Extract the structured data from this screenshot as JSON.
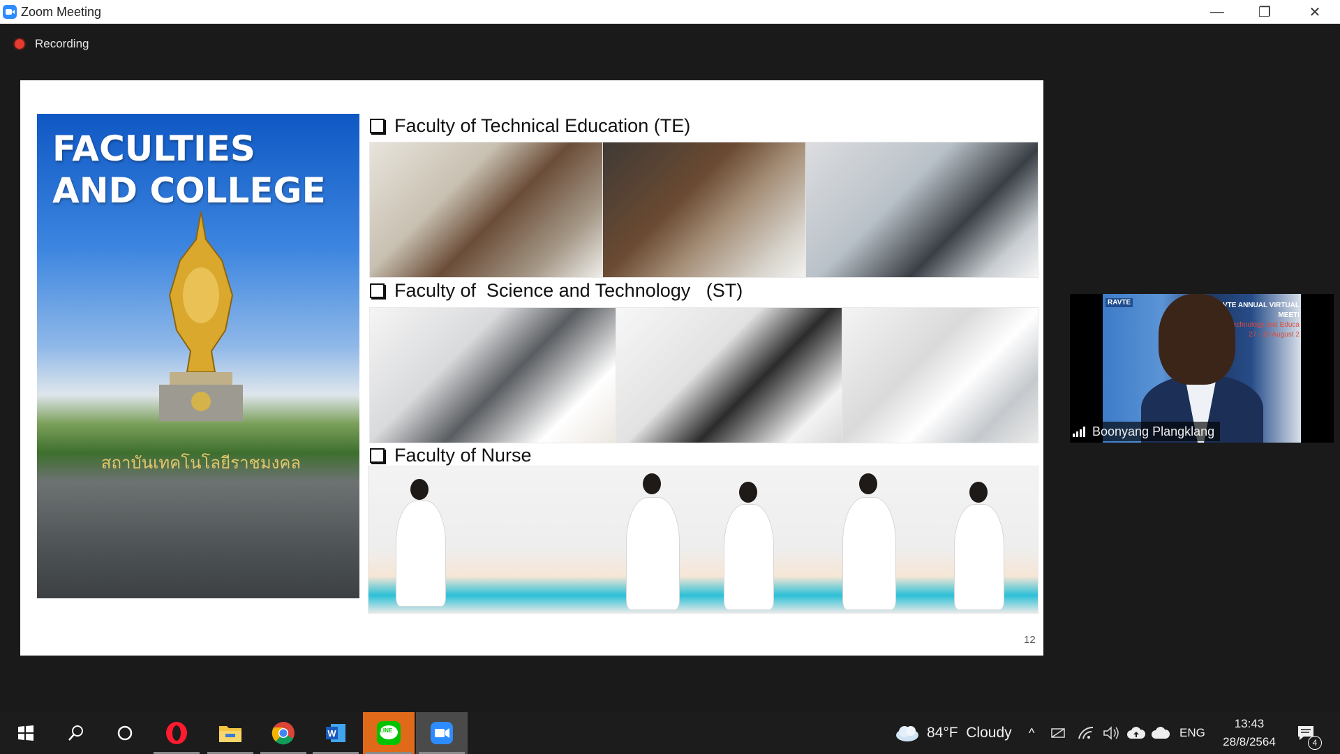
{
  "window": {
    "title": "Zoom Meeting",
    "minimize_glyph": "—",
    "restore_glyph": "❐",
    "close_glyph": "✕"
  },
  "recording": {
    "label": "Recording",
    "indicator_color": "#e63b2e"
  },
  "slide": {
    "hero_title": "FACULTIES AND COLLEGE",
    "hero_inscription": "สถาบันเทคโนโลยีราชมงคล",
    "sections": [
      {
        "heading": "Faculty of Technical Education (TE)"
      },
      {
        "heading": "Faculty of  Science and Technology   (ST)"
      },
      {
        "heading": "Faculty of Nurse"
      }
    ],
    "page_number": "12"
  },
  "participant": {
    "name": "Boonyang Plangklang",
    "banner_left": "RAVTE",
    "banner_right_1": "RAVTE ANNUAL VIRTUAL MEETI",
    "banner_right_2": "ersity of Technology and Educa",
    "banner_right_3": "27 - 28 August 2",
    "signal_icon": "signal-bars-icon"
  },
  "taskbar": {
    "apps": [
      {
        "name": "windows-start-icon"
      },
      {
        "name": "search-icon"
      },
      {
        "name": "cortana-icon"
      },
      {
        "name": "opera-icon"
      },
      {
        "name": "file-explorer-icon"
      },
      {
        "name": "chrome-icon"
      },
      {
        "name": "word-icon"
      },
      {
        "name": "line-icon",
        "label": "LINE"
      },
      {
        "name": "zoom-icon"
      }
    ],
    "weather": "84°F  Cloudy",
    "language": "ENG",
    "time": "13:43",
    "date": "28/8/2564",
    "notification_count": "4",
    "accent_zoom": "#2d8cff",
    "accent_line": "#00c300"
  }
}
